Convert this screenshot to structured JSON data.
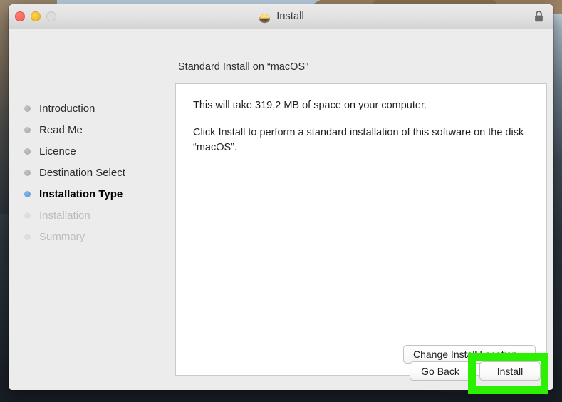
{
  "window": {
    "title": "Install",
    "app_icon": "installer-package-icon",
    "lock_icon": "lock-icon",
    "traffic_lights": [
      {
        "name": "close-button",
        "color": "#f9655c"
      },
      {
        "name": "minimize-button",
        "color": "#f3bb2a"
      },
      {
        "name": "zoom-button",
        "color": "#dcdcdc"
      }
    ]
  },
  "sidebar": {
    "steps": [
      {
        "label": "Introduction",
        "state": "done"
      },
      {
        "label": "Read Me",
        "state": "done"
      },
      {
        "label": "Licence",
        "state": "done"
      },
      {
        "label": "Destination Select",
        "state": "done"
      },
      {
        "label": "Installation Type",
        "state": "current"
      },
      {
        "label": "Installation",
        "state": "todo"
      },
      {
        "label": "Summary",
        "state": "todo"
      }
    ]
  },
  "main": {
    "heading": "Standard Install on “macOS”",
    "paragraphs": [
      "This will take 319.2 MB of space on your computer.",
      "Click Install to perform a standard installation of this software on the disk “macOS”."
    ],
    "change_location_label": "Change Install Location..."
  },
  "actions": {
    "go_back_label": "Go Back",
    "install_label": "Install"
  },
  "annotation": {
    "highlight_target": "install-button",
    "highlight_color": "#2bf000"
  },
  "colors": {
    "accent_blue": "#5b9bd8",
    "window_background": "#ececec",
    "content_background": "#ffffff",
    "highlight_green": "#2bf000"
  }
}
